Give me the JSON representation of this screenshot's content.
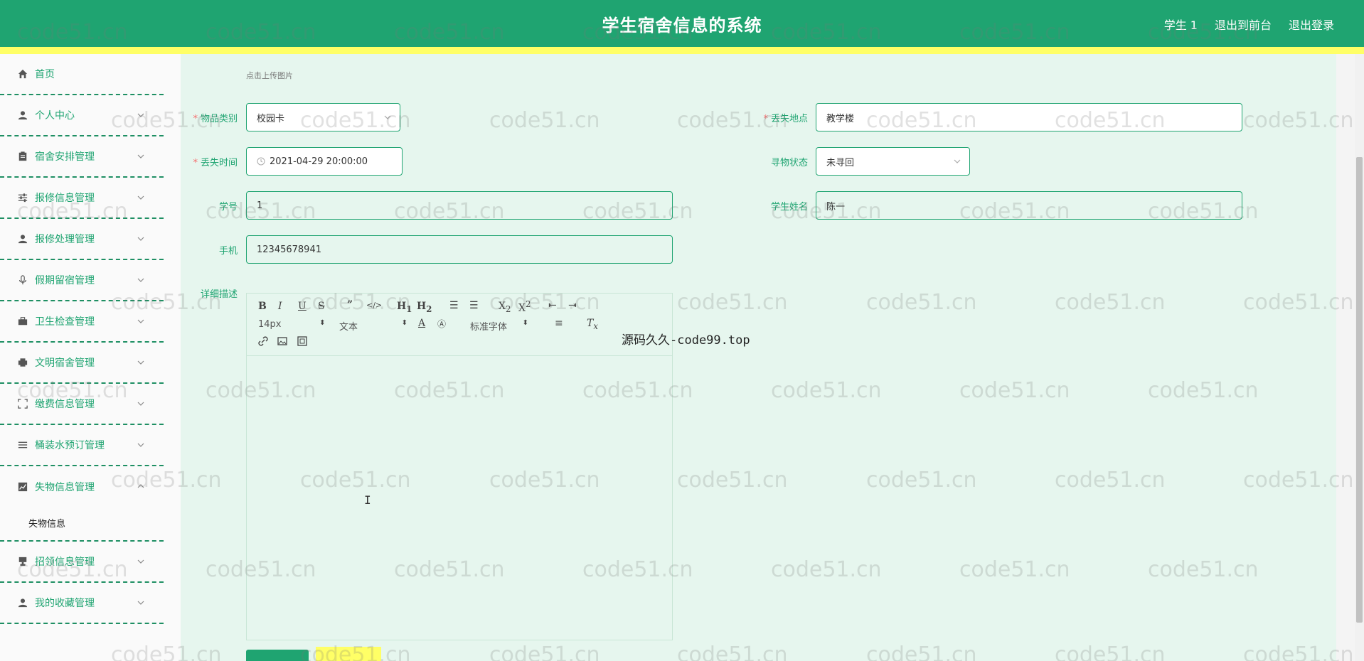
{
  "header": {
    "title": "学生宿舍信息的系统",
    "links": [
      "学生 1",
      "退出到前台",
      "退出登录"
    ]
  },
  "sidebar": {
    "items": [
      {
        "label": "首页",
        "icon": "home-icon"
      },
      {
        "label": "个人中心",
        "icon": "user-icon"
      },
      {
        "label": "宿舍安排管理",
        "icon": "clipboard-icon"
      },
      {
        "label": "报修信息管理",
        "icon": "sliders-icon"
      },
      {
        "label": "报修处理管理",
        "icon": "user-icon"
      },
      {
        "label": "假期留宿管理",
        "icon": "microphone-icon"
      },
      {
        "label": "卫生检查管理",
        "icon": "briefcase-icon"
      },
      {
        "label": "文明宿舍管理",
        "icon": "printer-icon"
      },
      {
        "label": "缴费信息管理",
        "icon": "expand-icon"
      },
      {
        "label": "桶装水预订管理",
        "icon": "list-icon"
      },
      {
        "label": "失物信息管理",
        "icon": "chart-icon"
      },
      {
        "label": "招领信息管理",
        "icon": "trophy-icon"
      },
      {
        "label": "我的收藏管理",
        "icon": "user-icon"
      }
    ],
    "submenu_label": "失物信息"
  },
  "form": {
    "upload_hint": "点击上传图片",
    "category": {
      "label": "物品类别",
      "value": "校园卡"
    },
    "location": {
      "label": "丢失地点",
      "value": "教学楼"
    },
    "lost_time": {
      "label": "丢失时间",
      "value": "2021-04-29 20:00:00"
    },
    "status": {
      "label": "寻物状态",
      "value": "未寻回"
    },
    "student_id": {
      "label": "学号",
      "value": "1"
    },
    "student_name": {
      "label": "学生姓名",
      "value": "陈一"
    },
    "phone": {
      "label": "手机",
      "value": "12345678941"
    },
    "description": {
      "label": "详细描述"
    }
  },
  "editor": {
    "font_size": "14px",
    "text_type": "文本",
    "font_family": "标准字体"
  },
  "overlay_text": "源码久久-code99.top",
  "watermark_text": "code51.cn",
  "colors": {
    "primary": "#1fa471",
    "highlight": "#ffff66",
    "background": "#e6f6ee"
  }
}
